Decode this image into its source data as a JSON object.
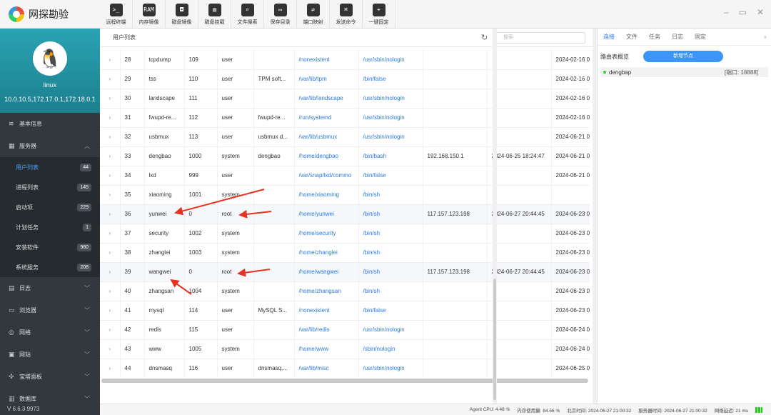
{
  "app": {
    "title": "网探勘验",
    "version": "V 6.6.3.9973"
  },
  "toolbar": [
    {
      "label": "远程终端",
      "icon": "terminal-icon",
      "glyph": ">_"
    },
    {
      "label": "内存镜像",
      "icon": "ram-icon",
      "glyph": "RAM"
    },
    {
      "label": "磁盘镜像",
      "icon": "disk-image-icon",
      "glyph": "◘"
    },
    {
      "label": "磁盘挂载",
      "icon": "disk-mount-icon",
      "glyph": "▤"
    },
    {
      "label": "文件搜索",
      "icon": "file-search-icon",
      "glyph": "⌕"
    },
    {
      "label": "保存目录",
      "icon": "folder-icon",
      "glyph": "▭"
    },
    {
      "label": "端口映射",
      "icon": "port-map-icon",
      "glyph": "⇄"
    },
    {
      "label": "发送命令",
      "icon": "command-icon",
      "glyph": "⌘"
    },
    {
      "label": "一键固定",
      "icon": "pin-icon",
      "glyph": "⌖"
    }
  ],
  "profile": {
    "name": "linux",
    "ips": "10.0.10.5,172.17.0.1,172.18.0.1"
  },
  "sidebar": {
    "basic_info": "基本信息",
    "services": "服务器",
    "sub_items": [
      {
        "label": "用户列表",
        "count": "44",
        "active": true
      },
      {
        "label": "进程列表",
        "count": "145"
      },
      {
        "label": "启动项",
        "count": "229"
      },
      {
        "label": "计划任务",
        "count": "1"
      },
      {
        "label": "安装软件",
        "count": "980"
      },
      {
        "label": "系统服务",
        "count": "208"
      }
    ],
    "more_items": [
      {
        "label": "日志",
        "icon": "log-icon"
      },
      {
        "label": "浏览器",
        "icon": "browser-icon"
      },
      {
        "label": "网络",
        "icon": "network-icon"
      },
      {
        "label": "网站",
        "icon": "website-icon"
      },
      {
        "label": "宝塔面板",
        "icon": "panel-icon"
      },
      {
        "label": "数据库",
        "icon": "database-icon"
      }
    ]
  },
  "main": {
    "title": "用户列表",
    "search_placeholder": "搜索",
    "rows": [
      [
        "28",
        "tcpdump",
        "109",
        "user",
        "",
        "/nonexistent",
        "/usr/sbin/nologin",
        "",
        "",
        "2024-02-16 0"
      ],
      [
        "29",
        "tss",
        "110",
        "user",
        "TPM soft...",
        "/var/lib/tpm",
        "/bin/false",
        "",
        "",
        "2024-02-16 0"
      ],
      [
        "30",
        "landscape",
        "111",
        "user",
        "",
        "/var/lib/landscape",
        "/usr/sbin/nologin",
        "",
        "",
        "2024-02-16 0"
      ],
      [
        "31",
        "fwupd-re...",
        "112",
        "user",
        "fwupd-re...",
        "/run/systemd",
        "/usr/sbin/nologin",
        "",
        "",
        "2024-02-16 0"
      ],
      [
        "32",
        "usbmux",
        "113",
        "user",
        "usbmux d...",
        "/var/lib/usbmux",
        "/usr/sbin/nologin",
        "",
        "",
        "2024-06-21 0"
      ],
      [
        "33",
        "dengbao",
        "1000",
        "system",
        "dengbao",
        "/home/dengbao",
        "/bin/bash",
        "192.168.150.1",
        "2024-06-25 18:24:47",
        "2024-06-21 0"
      ],
      [
        "34",
        "lxd",
        "999",
        "user",
        "",
        "/var/snap/lxd/commo",
        "/bin/false",
        "",
        "",
        "2024-06-21 0"
      ],
      [
        "35",
        "xiaoming",
        "1001",
        "system",
        "",
        "/home/xiaoming",
        "/bin/sh",
        "",
        "",
        ""
      ],
      [
        "36",
        "yunwei",
        "0",
        "root",
        "",
        "/home/yunwei",
        "/bin/sh",
        "117.157.123.198",
        "2024-06-27 20:44:45",
        "2024-06-23 0"
      ],
      [
        "37",
        "security",
        "1002",
        "system",
        "",
        "/home/security",
        "/bin/sh",
        "",
        "",
        "2024-06-23 0"
      ],
      [
        "38",
        "zhanglei",
        "1003",
        "system",
        "",
        "/home/zhanglei",
        "/bin/sh",
        "",
        "",
        "2024-06-23 0"
      ],
      [
        "39",
        "wangwei",
        "0",
        "root",
        "",
        "/home/wangwei",
        "/bin/sh",
        "117.157.123.198",
        "2024-06-27 20:44:45",
        "2024-06-23 0"
      ],
      [
        "40",
        "zhangsan",
        "1004",
        "system",
        "",
        "/home/zhangsan",
        "/bin/sh",
        "",
        "",
        "2024-06-23 0"
      ],
      [
        "41",
        "mysql",
        "114",
        "user",
        "MySQL S...",
        "/nonexistent",
        "/bin/false",
        "",
        "",
        "2024-06-23 0"
      ],
      [
        "42",
        "redis",
        "115",
        "user",
        "",
        "/var/lib/redis",
        "/usr/sbin/nologin",
        "",
        "",
        "2024-06-24 0"
      ],
      [
        "43",
        "www",
        "1005",
        "system",
        "",
        "/home/www",
        "/sbin/nologin",
        "",
        "",
        "2024-06-24 0"
      ],
      [
        "44",
        "dnsmasq",
        "116",
        "user",
        "dnsmasq,...",
        "/var/lib/misc",
        "/usr/sbin/nologin",
        "",
        "",
        "2024-06-25 0"
      ]
    ]
  },
  "right_panel": {
    "tabs": [
      "连接",
      "文件",
      "任务",
      "日志",
      "固定"
    ],
    "route_label": "路由表概览",
    "new_node": "新增节点",
    "node_name": "dengbap",
    "node_port": "[端口: 18888]"
  },
  "status": {
    "cpu": "Agent CPU: 4.48 %",
    "mem": "内存使用量: 84.56 %",
    "bj_time": "北京时间: 2024-06-27 21:00:32",
    "server_time": "服务器时间: 2024-06-27 21:00:32",
    "latency": "网络延迟: 21 ms"
  },
  "colors": {
    "accent": "#2a7ae2",
    "sidebar": "#32383e",
    "profile": "#1b8fa0",
    "arrow": "#e53322"
  }
}
